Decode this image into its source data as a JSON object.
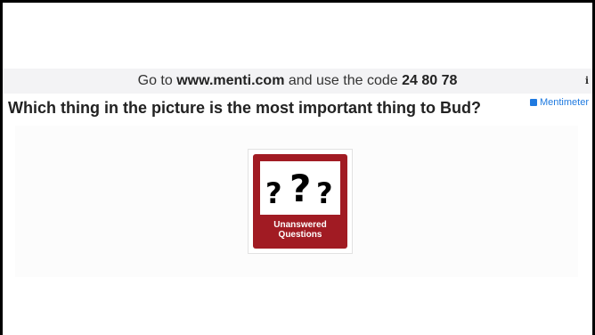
{
  "code_bar": {
    "prefix": "Go to ",
    "url": "www.menti.com",
    "middle": " and use the code ",
    "code": "24 80 78",
    "info_icon": "i"
  },
  "question": {
    "text": "Which thing in the picture is the most important thing to Bud?"
  },
  "brand": {
    "name": "Mentimeter",
    "color": "#1f7ae0"
  },
  "image": {
    "icon": "unanswered-questions-icon",
    "marks": "???",
    "label_line1": "Unanswered",
    "label_line2": "Questions",
    "color": "#a11b23"
  }
}
